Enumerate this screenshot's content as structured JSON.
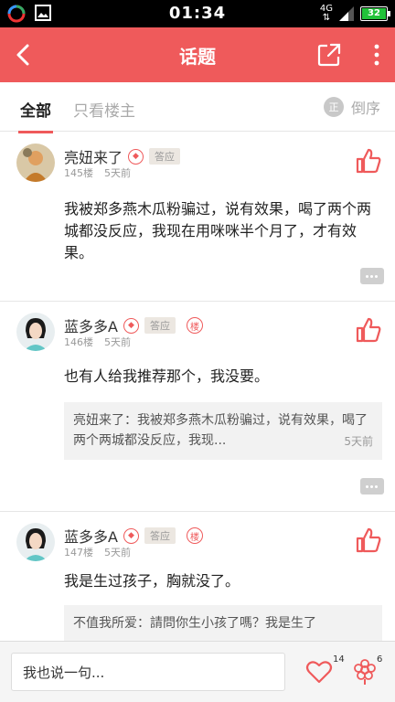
{
  "status": {
    "time": "01:34",
    "network": "4G",
    "battery": "32"
  },
  "appbar": {
    "title": "话题"
  },
  "filters": {
    "all": "全部",
    "owner_only": "只看楼主",
    "sort_icon": "正",
    "sort": "倒序"
  },
  "posts": [
    {
      "name": "亮妞来了",
      "badge": "答应",
      "floor": "145楼",
      "time": "5天前",
      "content": "我被郑多燕木瓜粉骗过，说有效果，喝了两个两城都没反应，我现在用咪咪半个月了，才有效果。"
    },
    {
      "name": "蓝多多A",
      "badge": "答应",
      "lou": "楼",
      "floor": "146楼",
      "time": "5天前",
      "content": "也有人给我推荐那个，我没要。",
      "quote": "亮妞来了：我被郑多燕木瓜粉骗过，说有效果，喝了两个两城都没反应，我现...",
      "quote_time": "5天前"
    },
    {
      "name": "蓝多多A",
      "badge": "答应",
      "lou": "楼",
      "floor": "147楼",
      "time": "5天前",
      "content": "我是生过孩子，胸就没了。",
      "quote": "不值我所爱：請問你生小孩了嗎？我是生了"
    }
  ],
  "bottom": {
    "placeholder": "我也说一句...",
    "likes": "14",
    "flowers": "6"
  },
  "colors": {
    "accent": "#ef5a5b"
  },
  "icons": [
    "back-icon",
    "share-icon",
    "more-icon",
    "thumb-up-icon",
    "comment-icon",
    "heart-icon",
    "flower-icon"
  ]
}
